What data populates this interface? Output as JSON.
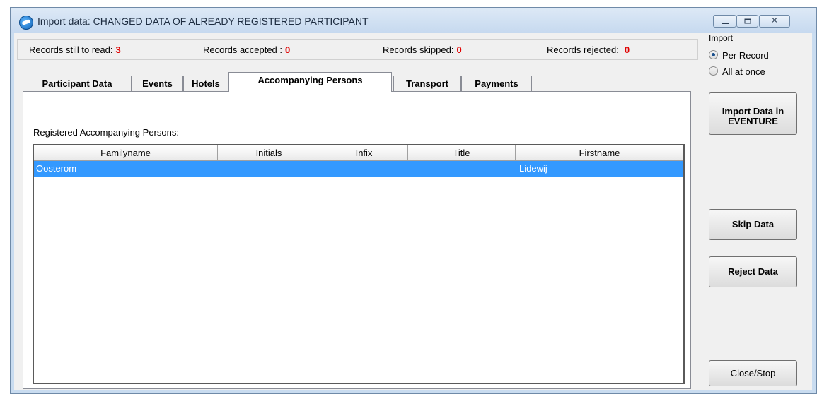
{
  "window": {
    "title": "Import data: CHANGED DATA OF ALREADY REGISTERED PARTICIPANT"
  },
  "records": {
    "to_read_label": "Records still to read:",
    "to_read_value": "3",
    "accepted_label": "Records accepted :",
    "accepted_value": "0",
    "skipped_label": "Records skipped:",
    "skipped_value": "0",
    "rejected_label": "Records rejected:",
    "rejected_value": "0",
    "value_color": "#e00000"
  },
  "import_group": {
    "title": "Import",
    "options": [
      {
        "label": "Per Record",
        "checked": true
      },
      {
        "label": "All at once",
        "checked": false
      }
    ]
  },
  "tabs": [
    {
      "label": "Participant Data",
      "active": false
    },
    {
      "label": "Events",
      "active": false
    },
    {
      "label": "Hotels",
      "active": false
    },
    {
      "label": "Accompanying Persons",
      "active": true
    },
    {
      "label": "Transport",
      "active": false
    },
    {
      "label": "Payments",
      "active": false
    }
  ],
  "tab_page": {
    "caption": "Registered Accompanying Persons:",
    "columns": [
      "Familyname",
      "Initials",
      "Infix",
      "Title",
      "Firstname"
    ],
    "rows": [
      {
        "familyname": "Oosterom",
        "initials": "",
        "infix": "",
        "title": "",
        "firstname": "Lidewij",
        "selected": true
      }
    ],
    "selection_color": "#3399ff"
  },
  "buttons": {
    "import_line1": "Import Data in",
    "import_line2": "EVENTURE",
    "skip": "Skip Data",
    "reject": "Reject Data",
    "close": "Close/Stop"
  },
  "icons": {
    "app": "eventure-app-icon",
    "minimize": "minimize-icon",
    "maximize": "maximize-icon",
    "close": "close-icon"
  }
}
